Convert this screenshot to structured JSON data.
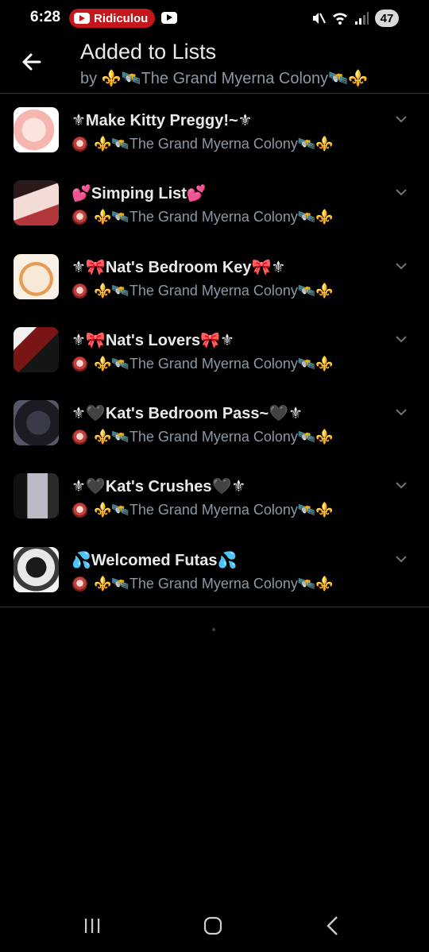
{
  "status_bar": {
    "time": "6:28",
    "notification_text": "Ridiculou",
    "battery": "47"
  },
  "header": {
    "title": "Added to Lists",
    "subtitle": "by ⚜️🛰️The Grand Myerna Colony🛰️⚜️"
  },
  "lists": [
    {
      "name": "⚜Make Kitty Preggy!~⚜",
      "owner": "⚜️🛰️The Grand Myerna Colony🛰️⚜️"
    },
    {
      "name": "💕Simping List💕",
      "owner": "⚜️🛰️The Grand Myerna Colony🛰️⚜️"
    },
    {
      "name": "⚜🎀Nat's Bedroom Key🎀⚜",
      "owner": "⚜️🛰️The Grand Myerna Colony🛰️⚜️"
    },
    {
      "name": "⚜🎀Nat's Lovers🎀⚜",
      "owner": "⚜️🛰️The Grand Myerna Colony🛰️⚜️"
    },
    {
      "name": "⚜🖤Kat's Bedroom Pass~🖤⚜",
      "owner": "⚜️🛰️The Grand Myerna Colony🛰️⚜️"
    },
    {
      "name": "⚜🖤Kat's Crushes🖤⚜",
      "owner": "⚜️🛰️The Grand Myerna Colony🛰️⚜️"
    },
    {
      "name": "💦Welcomed Futas💦",
      "owner": "⚜️🛰️The Grand Myerna Colony🛰️⚜️"
    }
  ],
  "icons": {
    "back": "back-arrow-icon",
    "expand": "chevron-down-icon",
    "nav_recent": "recent-apps-icon",
    "nav_home": "home-icon",
    "nav_back": "nav-back-icon"
  },
  "colors": {
    "background": "#000000",
    "primary_text": "#e7e9ea",
    "secondary_text": "#8b98a5",
    "divider": "#2f3336",
    "notification_pill": "#c4161c"
  }
}
